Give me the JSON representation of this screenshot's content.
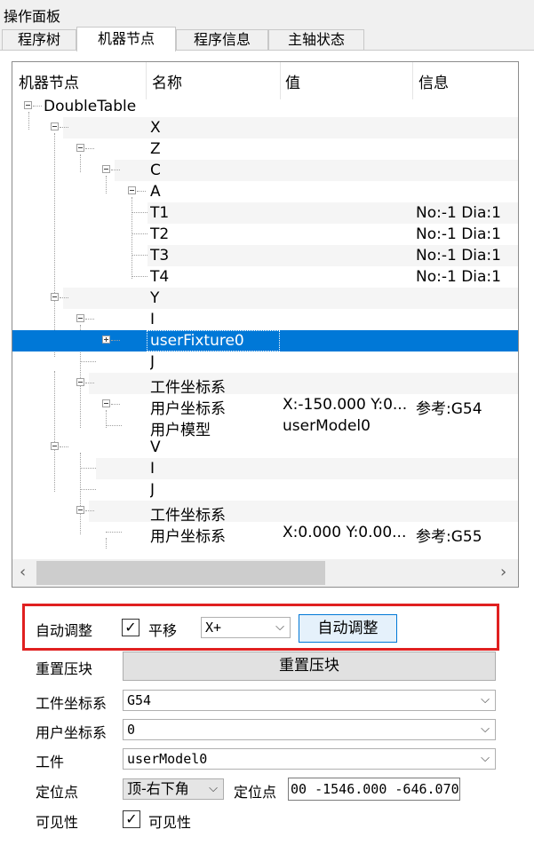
{
  "window": {
    "title": "操作面板"
  },
  "tabs": [
    {
      "label": "程序树"
    },
    {
      "label": "机器节点"
    },
    {
      "label": "程序信息"
    },
    {
      "label": "主轴状态"
    }
  ],
  "tree": {
    "columns": [
      "机器节点",
      "名称",
      "值",
      "信息"
    ],
    "root_label": "DoubleTable",
    "rows": [
      {
        "name": "X",
        "value": "",
        "info": ""
      },
      {
        "name": "Z",
        "value": "",
        "info": ""
      },
      {
        "name": "C",
        "value": "",
        "info": ""
      },
      {
        "name": "A",
        "value": "",
        "info": ""
      },
      {
        "name": "T1",
        "value": "",
        "info": "No:-1  Dia:1"
      },
      {
        "name": "T2",
        "value": "",
        "info": "No:-1  Dia:1"
      },
      {
        "name": "T3",
        "value": "",
        "info": "No:-1  Dia:1"
      },
      {
        "name": "T4",
        "value": "",
        "info": "No:-1  Dia:1"
      },
      {
        "name": "Y",
        "value": "",
        "info": ""
      },
      {
        "name": "I",
        "value": "",
        "info": ""
      },
      {
        "name": "userFixture0",
        "value": "",
        "info": "",
        "selected": true
      },
      {
        "name": "J",
        "value": "",
        "info": ""
      },
      {
        "name": "工件坐标系",
        "value": "",
        "info": ""
      },
      {
        "name": "用户坐标系",
        "value": "X:-150.000 Y:0...",
        "info": "参考:G54"
      },
      {
        "name": "用户模型",
        "value": "userModel0",
        "info": ""
      },
      {
        "name": "V",
        "value": "",
        "info": ""
      },
      {
        "name": "I",
        "value": "",
        "info": ""
      },
      {
        "name": "J",
        "value": "",
        "info": ""
      },
      {
        "name": "工件坐标系",
        "value": "",
        "info": ""
      },
      {
        "name": "用户坐标系",
        "value": "X:0.000 Y:0.00...",
        "info": "参考:G55"
      }
    ]
  },
  "auto_adjust": {
    "label": "自动调整",
    "translate_checked": true,
    "translate_label": "平移",
    "direction_value": "X+",
    "button_label": "自动调整"
  },
  "reset_clamp": {
    "label": "重置压块",
    "button_label": "重置压块"
  },
  "work_coord": {
    "label": "工件坐标系",
    "value": "G54"
  },
  "user_coord": {
    "label": "用户坐标系",
    "value": "0"
  },
  "workpiece": {
    "label": "工件",
    "value": "userModel0"
  },
  "locate": {
    "label": "定位点",
    "mode_value": "顶-右下角",
    "point_label": "定位点",
    "point_value": "00 -1546.000 -646.070"
  },
  "visibility": {
    "label": "可见性",
    "checked": true,
    "checkbox_label": "可见性"
  }
}
